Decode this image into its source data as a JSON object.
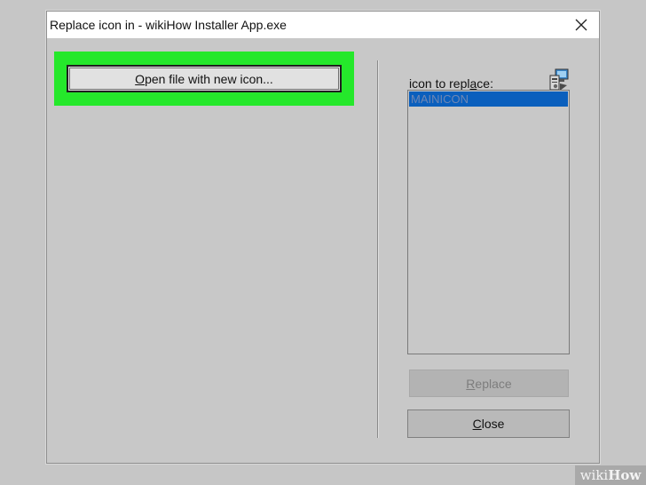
{
  "window": {
    "title": "Replace icon in - wikiHow Installer App.exe",
    "close_icon": "close-icon"
  },
  "left_panel": {
    "open_button": {
      "prefix": "",
      "mnemonic": "O",
      "suffix": "pen file with new icon..."
    },
    "highlight_color": "#25e82b"
  },
  "right_panel": {
    "label": {
      "prefix": "icon to repl",
      "mnemonic": "a",
      "suffix": "ce:"
    },
    "app_icon": "application-icon",
    "icon_list": {
      "items": [
        "MAINICON"
      ],
      "selected": "MAINICON",
      "selection_color": "#0a5fbd"
    },
    "replace_button": {
      "prefix": "",
      "mnemonic": "R",
      "suffix": "eplace",
      "enabled": false
    },
    "close_button": {
      "prefix": "",
      "mnemonic": "C",
      "suffix": "lose"
    }
  },
  "watermark": {
    "part1": "wiki",
    "part2": "How"
  }
}
